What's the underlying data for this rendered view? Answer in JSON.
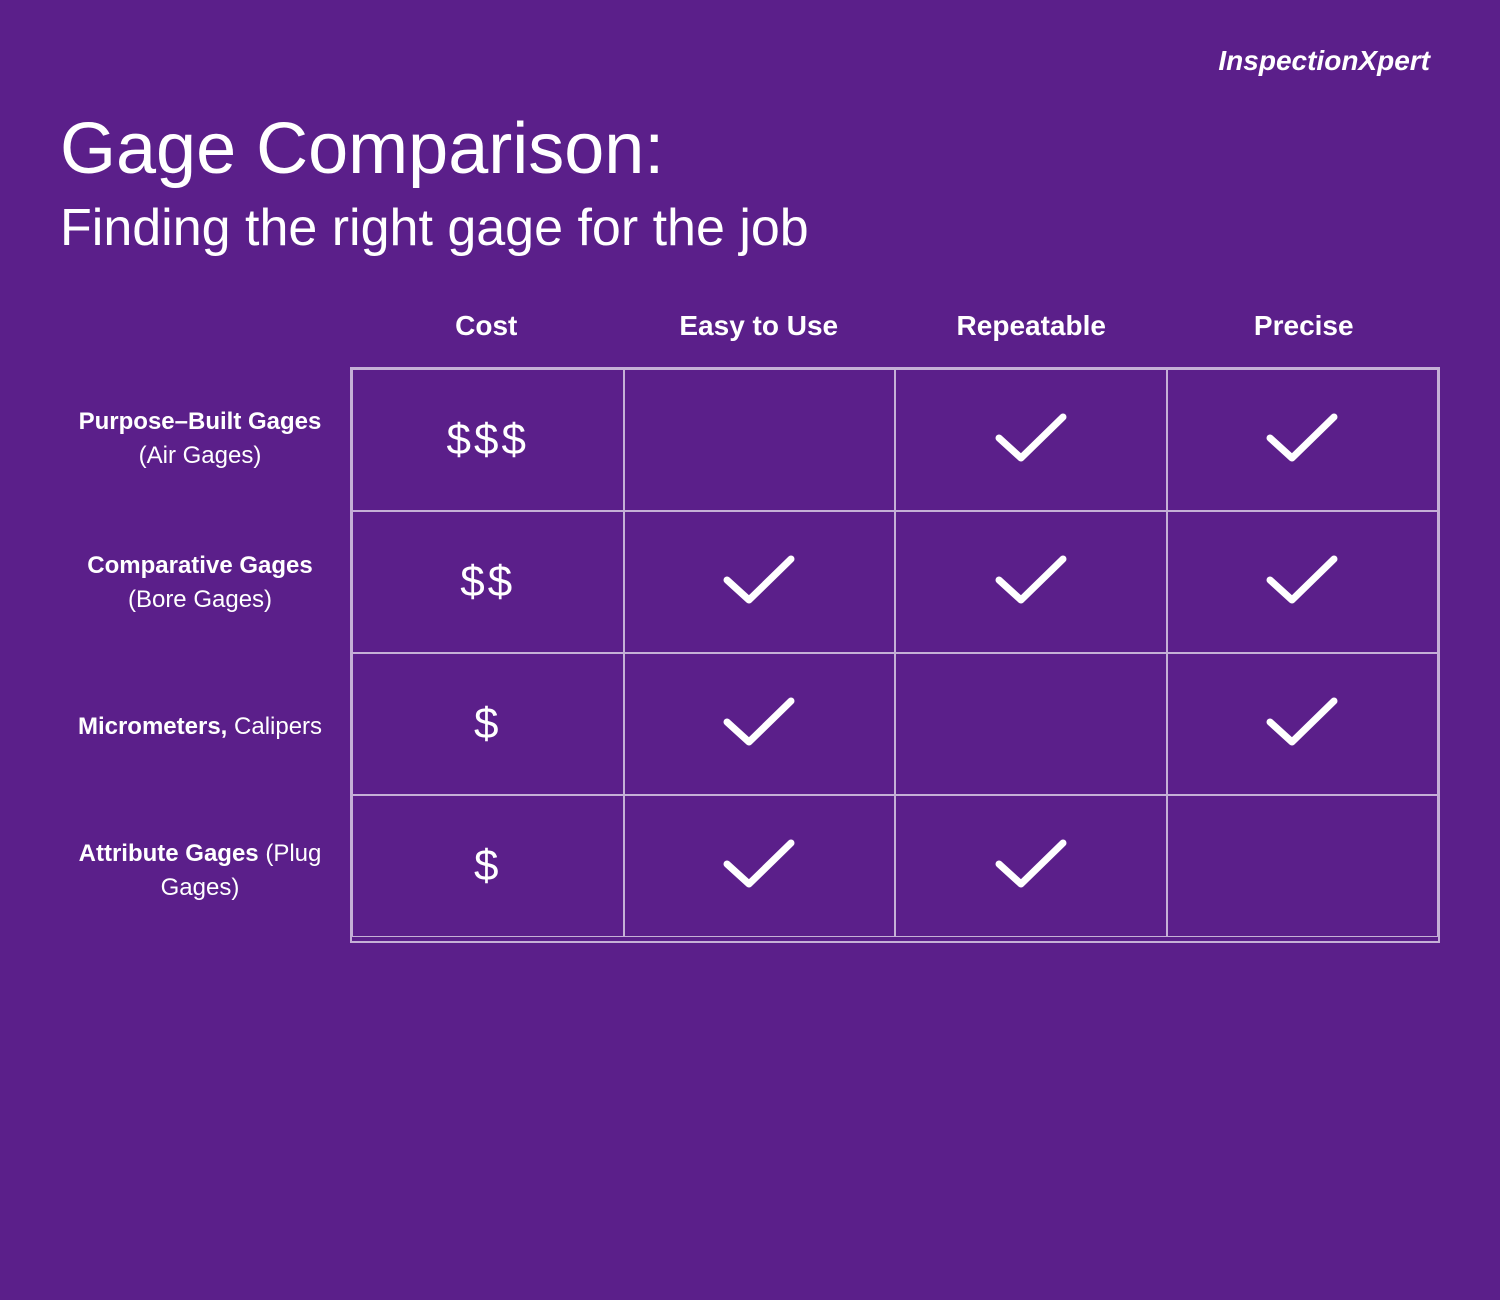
{
  "brand": {
    "name": "InspectionXpert"
  },
  "title": {
    "main": "Gage Comparison:",
    "sub": "Finding the right gage for the job"
  },
  "table": {
    "column_headers": [
      "Cost",
      "Easy to Use",
      "Repeatable",
      "Precise"
    ],
    "rows": [
      {
        "label_bold": "Purpose–Built Gages",
        "label_normal": " (Air Gages)",
        "cost": "$$$",
        "easy_to_use": false,
        "repeatable": true,
        "precise": true
      },
      {
        "label_bold": "Comparative Gages",
        "label_normal": " (Bore Gages)",
        "cost": "$$",
        "easy_to_use": true,
        "repeatable": true,
        "precise": true
      },
      {
        "label_bold": "Micrometers,",
        "label_normal": " Calipers",
        "cost": "$",
        "easy_to_use": true,
        "repeatable": false,
        "precise": true
      },
      {
        "label_bold": "Attribute Gages",
        "label_normal": " (Plug Gages)",
        "cost": "$",
        "easy_to_use": true,
        "repeatable": true,
        "precise": false
      }
    ]
  }
}
